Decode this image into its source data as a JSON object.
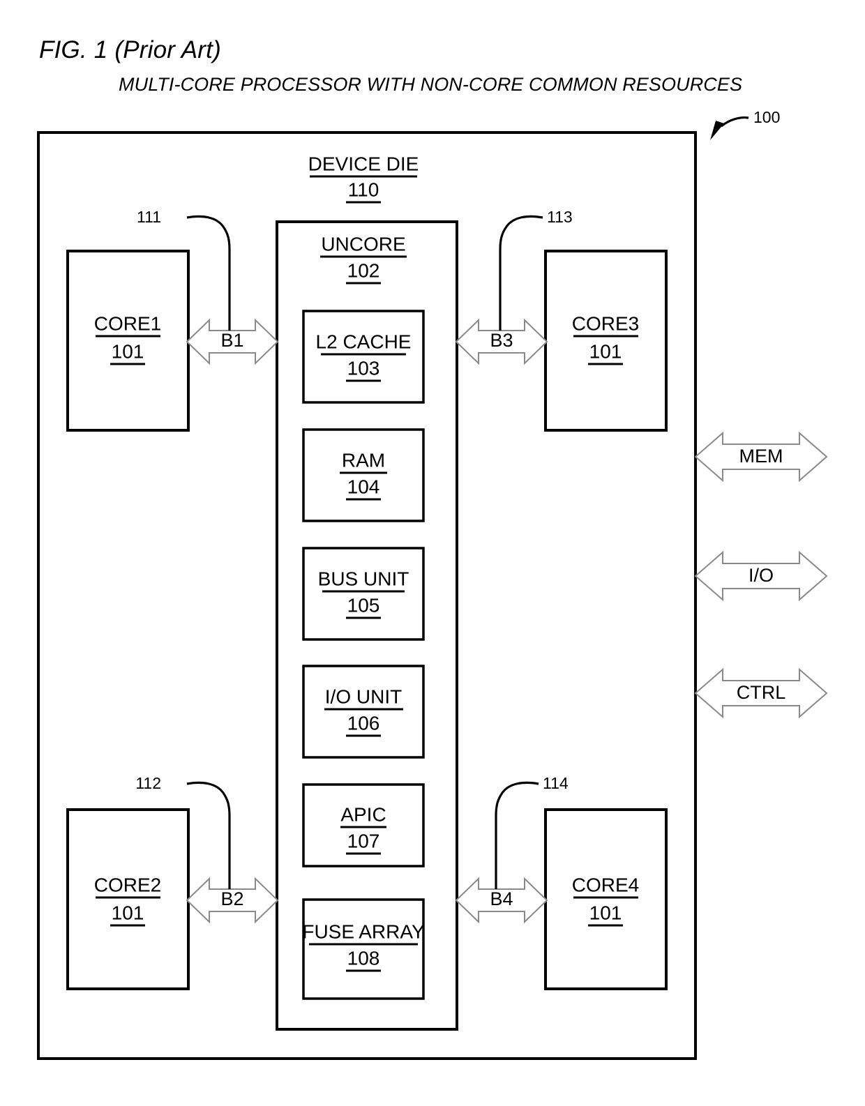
{
  "figure": {
    "number_label": "FIG. 1 (Prior Art)",
    "subtitle": "MULTI-CORE PROCESSOR WITH NON-CORE COMMON RESOURCES",
    "overall_ref": "100"
  },
  "die": {
    "title": "DEVICE DIE",
    "ref": "110"
  },
  "uncore": {
    "title": "UNCORE",
    "ref": "102",
    "blocks": [
      {
        "title": "L2 CACHE",
        "ref": "103"
      },
      {
        "title": "RAM",
        "ref": "104"
      },
      {
        "title": "BUS UNIT",
        "ref": "105"
      },
      {
        "title": "I/O UNIT",
        "ref": "106"
      },
      {
        "title": "APIC",
        "ref": "107"
      },
      {
        "title": "FUSE ARRAY",
        "ref": "108"
      }
    ]
  },
  "cores": [
    {
      "title": "CORE1",
      "ref": "101"
    },
    {
      "title": "CORE2",
      "ref": "101"
    },
    {
      "title": "CORE3",
      "ref": "101"
    },
    {
      "title": "CORE4",
      "ref": "101"
    }
  ],
  "buses": [
    {
      "label": "B1",
      "ref": "111"
    },
    {
      "label": "B2",
      "ref": "112"
    },
    {
      "label": "B3",
      "ref": "113"
    },
    {
      "label": "B4",
      "ref": "114"
    }
  ],
  "external_interfaces": [
    {
      "label": "MEM"
    },
    {
      "label": "I/O"
    },
    {
      "label": "CTRL"
    }
  ],
  "colors": {
    "ink": "#000000",
    "paper": "#ffffff",
    "arrow_outline": "#8a8a8a"
  }
}
